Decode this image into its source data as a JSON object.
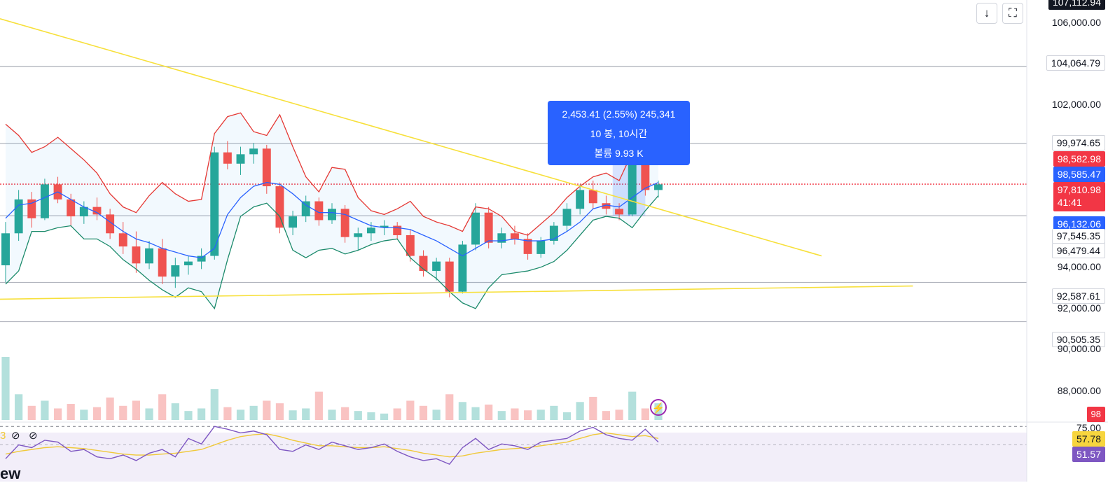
{
  "chart_data": {
    "type": "candlestick",
    "main": {
      "ylim": [
        89000,
        107000
      ],
      "price_ticks": [
        "106,000.00",
        "102,000.00",
        "94,000.00",
        "92,000.00",
        "90,000.00",
        "88,000.00"
      ],
      "horizontal_levels": [
        104064.79,
        99974.65,
        97810.98,
        96132.06,
        92587.61,
        90505.35
      ],
      "candles": [
        [
          93500,
          95800,
          92600,
          95200
        ],
        [
          95200,
          97500,
          94800,
          97000
        ],
        [
          97000,
          97400,
          95500,
          96000
        ],
        [
          96000,
          98100,
          95900,
          97800
        ],
        [
          97800,
          98200,
          96800,
          97000
        ],
        [
          97000,
          97300,
          95600,
          96100
        ],
        [
          96100,
          96900,
          95700,
          96600
        ],
        [
          96600,
          97100,
          95900,
          96200
        ],
        [
          96200,
          96500,
          94900,
          95200
        ],
        [
          95200,
          95800,
          94100,
          94500
        ],
        [
          94500,
          95300,
          93100,
          93600
        ],
        [
          93600,
          94800,
          93300,
          94400
        ],
        [
          94400,
          94900,
          92500,
          92900
        ],
        [
          92900,
          93900,
          92300,
          93500
        ],
        [
          93500,
          94000,
          93000,
          93700
        ],
        [
          93700,
          94400,
          93300,
          94000
        ],
        [
          94000,
          99800,
          93800,
          99500
        ],
        [
          99500,
          100100,
          98600,
          98900
        ],
        [
          98900,
          99800,
          98300,
          99400
        ],
        [
          99400,
          100000,
          98900,
          99700
        ],
        [
          99700,
          99900,
          97300,
          97700
        ],
        [
          97700,
          97900,
          95200,
          95500
        ],
        [
          95500,
          96400,
          95100,
          96100
        ],
        [
          96100,
          97200,
          95800,
          96900
        ],
        [
          96900,
          97100,
          95600,
          95900
        ],
        [
          95900,
          96800,
          95700,
          96500
        ],
        [
          96500,
          96700,
          94700,
          95000
        ],
        [
          95000,
          95500,
          94300,
          95200
        ],
        [
          95200,
          95800,
          94800,
          95500
        ],
        [
          95500,
          95900,
          95100,
          95600
        ],
        [
          95600,
          95800,
          94900,
          95100
        ],
        [
          95100,
          95400,
          93700,
          94000
        ],
        [
          94000,
          94300,
          92900,
          93200
        ],
        [
          93200,
          93900,
          92700,
          93700
        ],
        [
          93700,
          93900,
          91800,
          92100
        ],
        [
          92100,
          94800,
          92000,
          94600
        ],
        [
          94600,
          96800,
          94300,
          96300
        ],
        [
          96300,
          96600,
          94400,
          94700
        ],
        [
          94700,
          95500,
          94400,
          95200
        ],
        [
          95200,
          95600,
          94600,
          94900
        ],
        [
          94900,
          95200,
          93800,
          94100
        ],
        [
          94100,
          95000,
          93900,
          94800
        ],
        [
          94800,
          95800,
          94600,
          95600
        ],
        [
          95600,
          96800,
          95300,
          96500
        ],
        [
          96500,
          97800,
          96200,
          97500
        ],
        [
          97500,
          98000,
          96500,
          96800
        ],
        [
          96800,
          97200,
          96200,
          96500
        ],
        [
          96500,
          96800,
          95900,
          96200
        ],
        [
          96200,
          99500,
          96100,
          99100
        ],
        [
          99100,
          99300,
          97200,
          97500
        ],
        [
          97500,
          98000,
          97100,
          97800
        ]
      ],
      "bollinger_upper": [
        101000,
        100400,
        99500,
        99800,
        100300,
        99700,
        99100,
        98400,
        97300,
        96600,
        96300,
        97200,
        97900,
        97300,
        96900,
        97000,
        100500,
        101400,
        101600,
        100600,
        100400,
        101500,
        99800,
        98200,
        97400,
        98700,
        98600,
        97100,
        96400,
        96200,
        96500,
        96900,
        96100,
        95800,
        95600,
        95300,
        96600,
        96500,
        96100,
        95300,
        95100,
        95700,
        96300,
        97100,
        97700,
        98200,
        98400,
        98000,
        99500,
        100300,
        99600
      ],
      "bollinger_middle": [
        96000,
        96700,
        96800,
        97100,
        97400,
        97000,
        96600,
        96300,
        95800,
        95300,
        94900,
        94700,
        94400,
        94200,
        94000,
        93900,
        94400,
        96200,
        97100,
        97700,
        97900,
        97800,
        97300,
        96700,
        96300,
        96300,
        96200,
        95900,
        95600,
        95500,
        95500,
        95400,
        95100,
        94800,
        94400,
        94000,
        94400,
        94800,
        94800,
        94900,
        94800,
        94800,
        94900,
        95300,
        95800,
        96500,
        96700,
        96600,
        97100,
        97600,
        97900
      ],
      "bollinger_lower": [
        92500,
        93200,
        95300,
        95300,
        95500,
        95600,
        94900,
        94900,
        94500,
        93800,
        93300,
        92700,
        92200,
        91800,
        92300,
        92100,
        91200,
        93800,
        96100,
        96600,
        96800,
        96100,
        94300,
        93900,
        94300,
        94400,
        94100,
        94300,
        94600,
        94800,
        94900,
        93900,
        93300,
        92800,
        92100,
        91500,
        91200,
        92300,
        93000,
        93100,
        93200,
        93400,
        93700,
        94300,
        95100,
        95900,
        96100,
        96000,
        95500,
        96400,
        97200
      ],
      "trendlines": [
        {
          "from": [
            0,
            106600
          ],
          "to": [
            62.5,
            94000
          ],
          "color": "#f7e03b"
        },
        {
          "from": [
            0,
            91700
          ],
          "to": [
            69.5,
            92400
          ],
          "color": "#f7e03b"
        }
      ]
    },
    "volume": {
      "values": [
        98,
        40,
        22,
        30,
        18,
        25,
        16,
        20,
        35,
        22,
        30,
        18,
        40,
        26,
        14,
        18,
        48,
        20,
        16,
        22,
        30,
        26,
        15,
        18,
        44,
        16,
        20,
        14,
        12,
        10,
        18,
        30,
        22,
        16,
        40,
        28,
        20,
        24,
        14,
        18,
        15,
        16,
        22,
        12,
        28,
        36,
        14,
        16,
        44,
        18,
        26
      ],
      "last_value_label": "98"
    },
    "rsi": {
      "upper_band_label": "75.00",
      "ma_value_label": "57.78",
      "rsi_value_label": "51.57",
      "values": [
        40,
        55,
        52,
        60,
        58,
        48,
        50,
        42,
        40,
        44,
        38,
        46,
        50,
        42,
        62,
        56,
        75,
        72,
        68,
        70,
        66,
        50,
        48,
        55,
        50,
        58,
        54,
        50,
        52,
        56,
        48,
        42,
        38,
        40,
        34,
        52,
        62,
        50,
        56,
        54,
        50,
        58,
        60,
        62,
        70,
        74,
        66,
        62,
        60,
        72,
        58
      ],
      "ma_values": [
        45,
        48,
        50,
        52,
        53,
        52,
        51,
        49,
        47,
        45,
        44,
        44,
        45,
        46,
        48,
        50,
        55,
        60,
        64,
        66,
        67,
        64,
        60,
        57,
        54,
        54,
        53,
        52,
        52,
        53,
        51,
        49,
        46,
        44,
        42,
        43,
        46,
        48,
        50,
        51,
        52,
        54,
        56,
        58,
        62,
        66,
        68,
        66,
        64,
        65,
        62
      ],
      "overbought": 75,
      "oversold": 25
    }
  },
  "price_axis": {
    "top_tag": "107,112.94",
    "tags": {
      "level_104": "104,064.79",
      "level_99": "99,974.65",
      "red_level": "98,582.98",
      "blue_level": "98,585.47",
      "current_price": "97,810.98",
      "countdown": "41:41",
      "blue_bottom": "96,132.06",
      "level_97_5": "97,545.35",
      "level_96_4": "96,479.44",
      "level_92": "92,587.61",
      "level_90": "90,505.35"
    }
  },
  "measurement_tooltip": {
    "line1": "2,453.41 (2.55%) 245,341",
    "line2": "10 봉, 10시간",
    "line3": "볼륨 9.93 K"
  },
  "controls": {
    "scroll_down_icon": "↓",
    "fullscreen_icon": "⛶"
  },
  "indicator_header": {
    "value_fragment": "3",
    "hide_icon_1": "⊘",
    "hide_icon_2": "⊘"
  },
  "watermark_fragment": "ew",
  "colors": {
    "bull": "#26a69a",
    "bear": "#ef5350",
    "bb_upper": "#e53935",
    "bb_middle": "#2962ff",
    "bb_lower": "#1b8a6b",
    "trendline": "#f7e03b",
    "rsi": "#7e57c2",
    "rsi_ma": "#f0c93a"
  }
}
